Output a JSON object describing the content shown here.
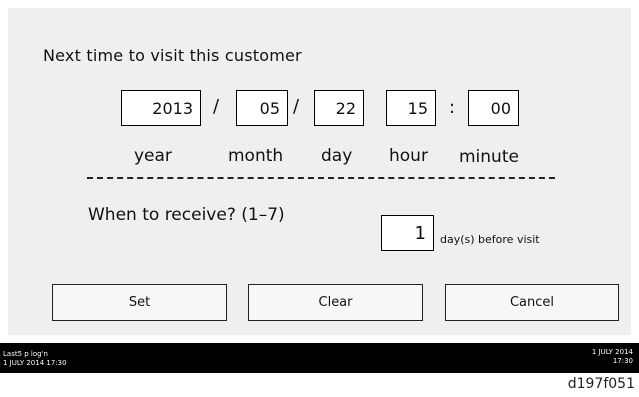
{
  "dialog": {
    "title": "Next time to visit this customer",
    "date": {
      "year": "2013",
      "month": "05",
      "day": "22",
      "hour": "15",
      "minute": "00",
      "date_separator": "/",
      "time_separator": ":"
    },
    "labels": {
      "year": "year",
      "month": "month",
      "day": "day",
      "hour": "hour",
      "minute": "minute"
    },
    "receive_question": "When to receive? (1–7)",
    "receive_value": "1",
    "receive_suffix": "day(s) before visit"
  },
  "buttons": {
    "set": "Set",
    "clear": "Clear",
    "cancel": "Cancel"
  },
  "statusbar": {
    "left_line1": "Last5 p log'n",
    "left_line2": "1 JULY 2014 17:30",
    "right_line1": "1 JULY 2014",
    "right_line2": "17:30"
  },
  "figure_id": "d197f051"
}
